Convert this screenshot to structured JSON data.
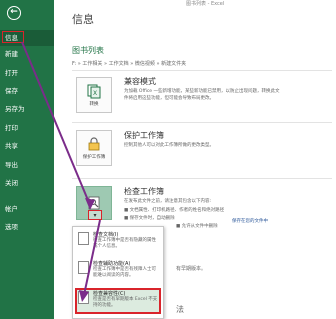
{
  "sidebar": {
    "back_glyph": "←",
    "items": [
      {
        "label": "信息"
      },
      {
        "label": "新建"
      },
      {
        "label": "打开"
      },
      {
        "label": "保存"
      },
      {
        "label": "另存为"
      },
      {
        "label": "打印"
      },
      {
        "label": "共享"
      },
      {
        "label": "导出"
      },
      {
        "label": "关闭"
      },
      {
        "label": "帐户"
      },
      {
        "label": "选项"
      }
    ],
    "accent": "#217346"
  },
  "window_title": "图书列表 - Excel",
  "page_title": "信息",
  "document": {
    "title": "图书列表",
    "path": "F: » 工作相关 » 工作文档 » 微信视频 » 新建文件夹"
  },
  "sections": {
    "compat": {
      "title": "兼容模式",
      "tile_label": "转换",
      "desc1": "为加载 Office 一些新增功能，某些新功能已禁用，以防止出现问题，转换此文",
      "desc2": "件将启用这些功能，但可能会导致布局更改。"
    },
    "protect": {
      "title": "保护工作簿",
      "tile_label": "保护工作簿",
      "desc1": "控制其他人可以对此工作簿所做的更改类型。"
    },
    "inspect": {
      "title": "检查工作簿",
      "desc1": "在发布此文件之前，请注意其包含以下内容:",
      "line1": "■ 文档属性、打印机路径、作者的姓名和绝对路径",
      "line2": "■ 保存文件时，自动删除",
      "line3": "■ 允许从文件中删除",
      "link": "保存在您的文件中"
    }
  },
  "menu": {
    "items": [
      {
        "title": "检查文档(I)",
        "desc": "检查工作簿中是否有隐藏的属性或个人信息。"
      },
      {
        "title": "检查辅助功能(A)",
        "desc": "检查工作簿中是否有残障人士可能难以阅读的内容。"
      },
      {
        "title": "检查兼容性(C)",
        "desc": "检查是否有早期版本 Excel 不支持的功能。"
      }
    ]
  },
  "bottom": {
    "line1": "有早期版本。",
    "line2": "法"
  }
}
